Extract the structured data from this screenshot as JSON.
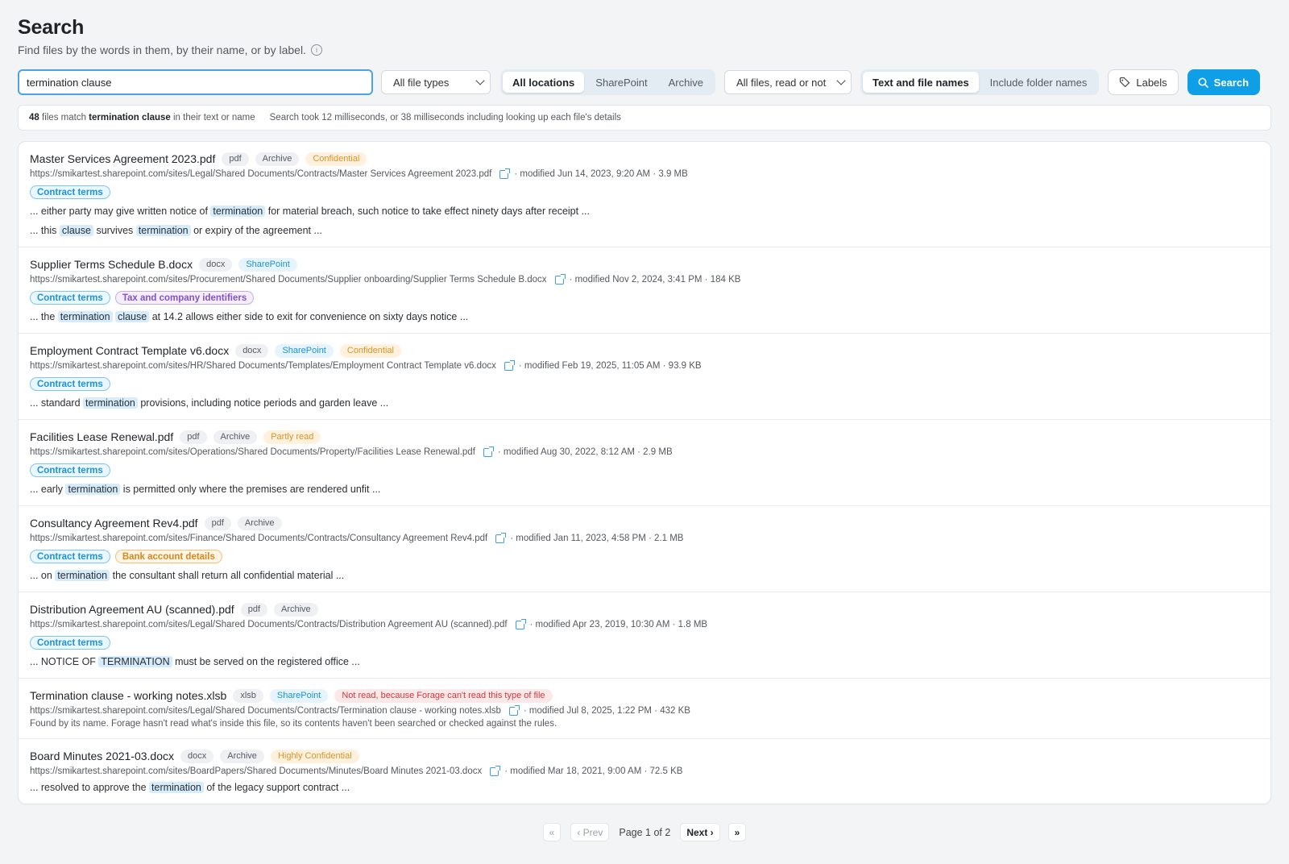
{
  "header": {
    "title": "Search",
    "subtitle": "Find files by the words in them, by their name, or by label.",
    "info_glyph": "i"
  },
  "toolbar": {
    "query": "termination clause",
    "file_type": "All file types",
    "locations": [
      "All locations",
      "SharePoint",
      "Archive"
    ],
    "read_state": "All files, read or not",
    "scope": [
      "Text and file names",
      "Include folder names"
    ],
    "labels_label": "Labels",
    "search_label": "Search"
  },
  "status": {
    "count": "48",
    "files_match": "files match",
    "query": "termination clause",
    "suffix": "in their text or name",
    "timing": "Search took 12 milliseconds, or 38 milliseconds including looking up each file's details"
  },
  "results": [
    {
      "name": "Master Services Agreement 2023.pdf",
      "chips": [
        {
          "text": "pdf",
          "tone": "gray"
        },
        {
          "text": "Archive",
          "tone": "gray"
        },
        {
          "text": "Confidential",
          "tone": "orange"
        }
      ],
      "url": "https://smikartest.sharepoint.com/sites/Legal/Shared Documents/Contracts/Master Services Agreement 2023.pdf",
      "meta": "· modified Jun 14, 2023, 9:20 AM · 3.9 MB",
      "tags": [
        {
          "text": "Contract terms",
          "tone": "blue"
        }
      ],
      "snippets": [
        [
          {
            "t": "... either party may give written notice of "
          },
          {
            "t": "termination",
            "hl": true
          },
          {
            "t": " for material breach, such notice to take effect ninety days after receipt ..."
          }
        ],
        [
          {
            "t": "... this "
          },
          {
            "t": "clause",
            "hl": true
          },
          {
            "t": " survives "
          },
          {
            "t": "termination",
            "hl": true
          },
          {
            "t": " or expiry of the agreement ..."
          }
        ]
      ]
    },
    {
      "name": "Supplier Terms Schedule B.docx",
      "chips": [
        {
          "text": "docx",
          "tone": "gray"
        },
        {
          "text": "SharePoint",
          "tone": "blue"
        }
      ],
      "url": "https://smikartest.sharepoint.com/sites/Procurement/Shared Documents/Supplier onboarding/Supplier Terms Schedule B.docx",
      "meta": "· modified Nov 2, 2024, 3:41 PM · 184 KB",
      "tags": [
        {
          "text": "Contract terms",
          "tone": "blue"
        },
        {
          "text": "Tax and company identifiers",
          "tone": "purple"
        }
      ],
      "snippets": [
        [
          {
            "t": "... the "
          },
          {
            "t": "termination",
            "hl": true
          },
          {
            "t": " "
          },
          {
            "t": "clause",
            "hl": true
          },
          {
            "t": " at 14.2 allows either side to exit for convenience on sixty days notice ..."
          }
        ]
      ]
    },
    {
      "name": "Employment Contract Template v6.docx",
      "chips": [
        {
          "text": "docx",
          "tone": "gray"
        },
        {
          "text": "SharePoint",
          "tone": "blue"
        },
        {
          "text": "Confidential",
          "tone": "orange"
        }
      ],
      "url": "https://smikartest.sharepoint.com/sites/HR/Shared Documents/Templates/Employment Contract Template v6.docx",
      "meta": "· modified Feb 19, 2025, 11:05 AM · 93.9 KB",
      "tags": [
        {
          "text": "Contract terms",
          "tone": "blue"
        }
      ],
      "snippets": [
        [
          {
            "t": "... standard "
          },
          {
            "t": "termination",
            "hl": true
          },
          {
            "t": " provisions, including notice periods and garden leave ..."
          }
        ]
      ]
    },
    {
      "name": "Facilities Lease Renewal.pdf",
      "chips": [
        {
          "text": "pdf",
          "tone": "gray"
        },
        {
          "text": "Archive",
          "tone": "gray"
        },
        {
          "text": "Partly read",
          "tone": "orange"
        }
      ],
      "url": "https://smikartest.sharepoint.com/sites/Operations/Shared Documents/Property/Facilities Lease Renewal.pdf",
      "meta": "· modified Aug 30, 2022, 8:12 AM · 2.9 MB",
      "tags": [
        {
          "text": "Contract terms",
          "tone": "blue"
        }
      ],
      "snippets": [
        [
          {
            "t": "... early "
          },
          {
            "t": "termination",
            "hl": true
          },
          {
            "t": " is permitted only where the premises are rendered unfit ..."
          }
        ]
      ]
    },
    {
      "name": "Consultancy Agreement Rev4.pdf",
      "chips": [
        {
          "text": "pdf",
          "tone": "gray"
        },
        {
          "text": "Archive",
          "tone": "gray"
        }
      ],
      "url": "https://smikartest.sharepoint.com/sites/Finance/Shared Documents/Contracts/Consultancy Agreement Rev4.pdf",
      "meta": "· modified Jan 11, 2023, 4:58 PM · 2.1 MB",
      "tags": [
        {
          "text": "Contract terms",
          "tone": "blue"
        },
        {
          "text": "Bank account details",
          "tone": "orange"
        }
      ],
      "snippets": [
        [
          {
            "t": "... on "
          },
          {
            "t": "termination",
            "hl": true
          },
          {
            "t": " the consultant shall return all confidential material ..."
          }
        ]
      ]
    },
    {
      "name": "Distribution Agreement AU (scanned).pdf",
      "chips": [
        {
          "text": "pdf",
          "tone": "gray"
        },
        {
          "text": "Archive",
          "tone": "gray"
        }
      ],
      "url": "https://smikartest.sharepoint.com/sites/Legal/Shared Documents/Contracts/Distribution Agreement AU (scanned).pdf",
      "meta": "· modified Apr 23, 2019, 10:30 AM · 1.8 MB",
      "tags": [
        {
          "text": "Contract terms",
          "tone": "blue"
        }
      ],
      "snippets": [
        [
          {
            "t": "... NOTICE OF "
          },
          {
            "t": "TERMINATION",
            "hl": true
          },
          {
            "t": " must be served on the registered office ..."
          }
        ]
      ]
    },
    {
      "name": "Termination clause - working notes.xlsb",
      "chips": [
        {
          "text": "xlsb",
          "tone": "gray"
        },
        {
          "text": "SharePoint",
          "tone": "blue"
        },
        {
          "text": "Not read, because Forage can't read this type of file",
          "tone": "red"
        }
      ],
      "url": "https://smikartest.sharepoint.com/sites/Legal/Shared Documents/Contracts/Termination clause - working notes.xlsb",
      "meta": "· modified Jul 8, 2025, 1:22 PM · 432 KB",
      "note": "Found by its name. Forage hasn't read what's inside this file, so its contents haven't been searched or checked against the rules.",
      "tags": [],
      "snippets": []
    },
    {
      "name": "Board Minutes 2021-03.docx",
      "chips": [
        {
          "text": "docx",
          "tone": "gray"
        },
        {
          "text": "Archive",
          "tone": "gray"
        },
        {
          "text": "Highly Confidential",
          "tone": "orange"
        }
      ],
      "url": "https://smikartest.sharepoint.com/sites/BoardPapers/Shared Documents/Minutes/Board Minutes 2021-03.docx",
      "meta": "· modified Mar 18, 2021, 9:00 AM · 72.5 KB",
      "tags": [],
      "snippets": [
        [
          {
            "t": "... resolved to approve the "
          },
          {
            "t": "termination",
            "hl": true
          },
          {
            "t": " of the legacy support contract ..."
          }
        ]
      ]
    }
  ],
  "pager": {
    "first": "«",
    "prev": "‹ Prev",
    "page_label": "Page 1 of 2",
    "next": "Next ›",
    "last": "»"
  }
}
